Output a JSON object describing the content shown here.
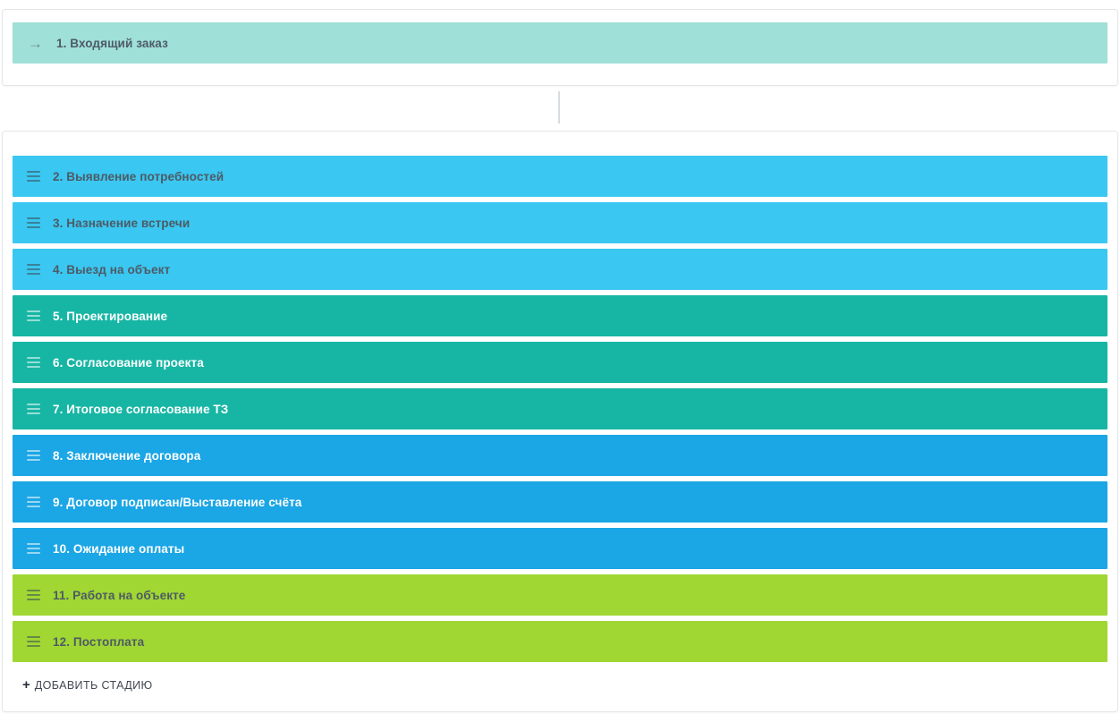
{
  "palette": {
    "page_background": "#ffffff",
    "card_background": "#ffffff",
    "card_border": "#e3e6e8",
    "connector_line": "#d6dce0",
    "dark_text": "#4e5a65",
    "light_text": "#ffffff"
  },
  "funnel": {
    "start_stage": {
      "label": "1. Входящий заказ",
      "color": "#9fe0d8",
      "text_color": "#4e5a65",
      "icon": "arrow-right-icon",
      "arrow_glyph": "→"
    },
    "stages": [
      {
        "label": "2. Выявление потребностей",
        "color": "#3ac7f1",
        "text_color": "#4e5a65",
        "handle": "dark"
      },
      {
        "label": "3. Назначение встречи",
        "color": "#3ac7f1",
        "text_color": "#4e5a65",
        "handle": "dark"
      },
      {
        "label": "4. Выезд на объект",
        "color": "#3ac7f1",
        "text_color": "#4e5a65",
        "handle": "dark"
      },
      {
        "label": "5. Проектирование",
        "color": "#17b6a4",
        "text_color": "#ffffff",
        "handle": "light"
      },
      {
        "label": "6. Согласование проекта",
        "color": "#17b6a4",
        "text_color": "#ffffff",
        "handle": "light"
      },
      {
        "label": "7. Итоговое согласование ТЗ",
        "color": "#17b6a4",
        "text_color": "#ffffff",
        "handle": "light"
      },
      {
        "label": "8. Заключение договора",
        "color": "#1ba6e5",
        "text_color": "#ffffff",
        "handle": "light"
      },
      {
        "label": "9. Договор подписан/Выставление счёта",
        "color": "#1ba6e5",
        "text_color": "#ffffff",
        "handle": "light"
      },
      {
        "label": "10. Ожидание оплаты",
        "color": "#1ba6e5",
        "text_color": "#ffffff",
        "handle": "light"
      },
      {
        "label": "11. Работа на объекте",
        "color": "#a0d733",
        "text_color": "#4e5a65",
        "handle": "dark"
      },
      {
        "label": "12. Постоплата",
        "color": "#a0d733",
        "text_color": "#4e5a65",
        "handle": "dark"
      }
    ],
    "add_stage": {
      "plus": "+",
      "label": "ДОБАВИТЬ СТАДИЮ"
    }
  }
}
